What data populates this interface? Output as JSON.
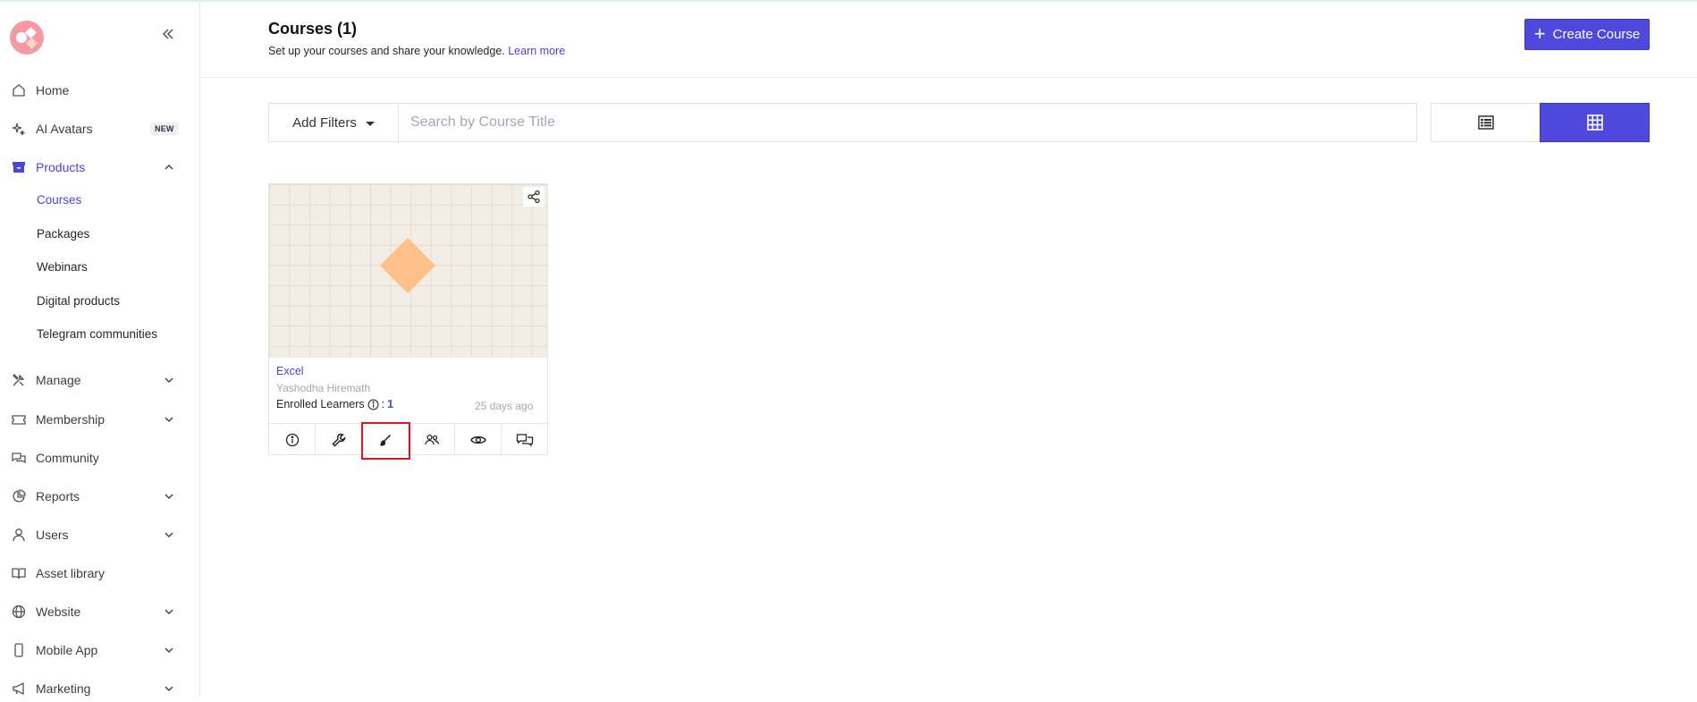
{
  "app": {
    "brand_color": "#4e48dd",
    "accent_text": "#4a46d8"
  },
  "sidebar": {
    "items": [
      {
        "label": "Home",
        "icon": "home-icon"
      },
      {
        "label": "AI Avatars",
        "icon": "sparkle-icon",
        "badge": "NEW"
      },
      {
        "label": "Products",
        "icon": "archive-icon",
        "expanded": true
      },
      {
        "label": "Manage",
        "icon": "tools-icon"
      },
      {
        "label": "Membership",
        "icon": "ticket-icon"
      },
      {
        "label": "Community",
        "icon": "chat-icon"
      },
      {
        "label": "Reports",
        "icon": "pie-chart-icon"
      },
      {
        "label": "Users",
        "icon": "user-icon"
      },
      {
        "label": "Asset library",
        "icon": "book-icon"
      },
      {
        "label": "Website",
        "icon": "globe-icon"
      },
      {
        "label": "Mobile App",
        "icon": "mobile-icon"
      },
      {
        "label": "Marketing",
        "icon": "megaphone-icon"
      }
    ],
    "products_sub": [
      {
        "label": "Courses",
        "active": true
      },
      {
        "label": "Packages"
      },
      {
        "label": "Webinars"
      },
      {
        "label": "Digital products"
      },
      {
        "label": "Telegram communities"
      }
    ]
  },
  "header": {
    "title": "Courses (1)",
    "subtitle": "Set up your courses and share your knowledge.",
    "learn_more": "Learn more",
    "create_button": "Create Course"
  },
  "filters": {
    "add_filters_label": "Add Filters",
    "search_placeholder": "Search by Course Title",
    "search_value": "",
    "view_mode": "grid"
  },
  "courses": [
    {
      "title": "Excel",
      "author": "Yashodha Hiremath",
      "enrolled_label": "Enrolled Learners",
      "enrolled_separator": ":",
      "enrolled_count": "1",
      "updated": "25 days ago",
      "actions": [
        "info-icon",
        "wrench-icon",
        "brush-icon",
        "users-icon",
        "eye-icon",
        "comments-icon"
      ]
    }
  ]
}
